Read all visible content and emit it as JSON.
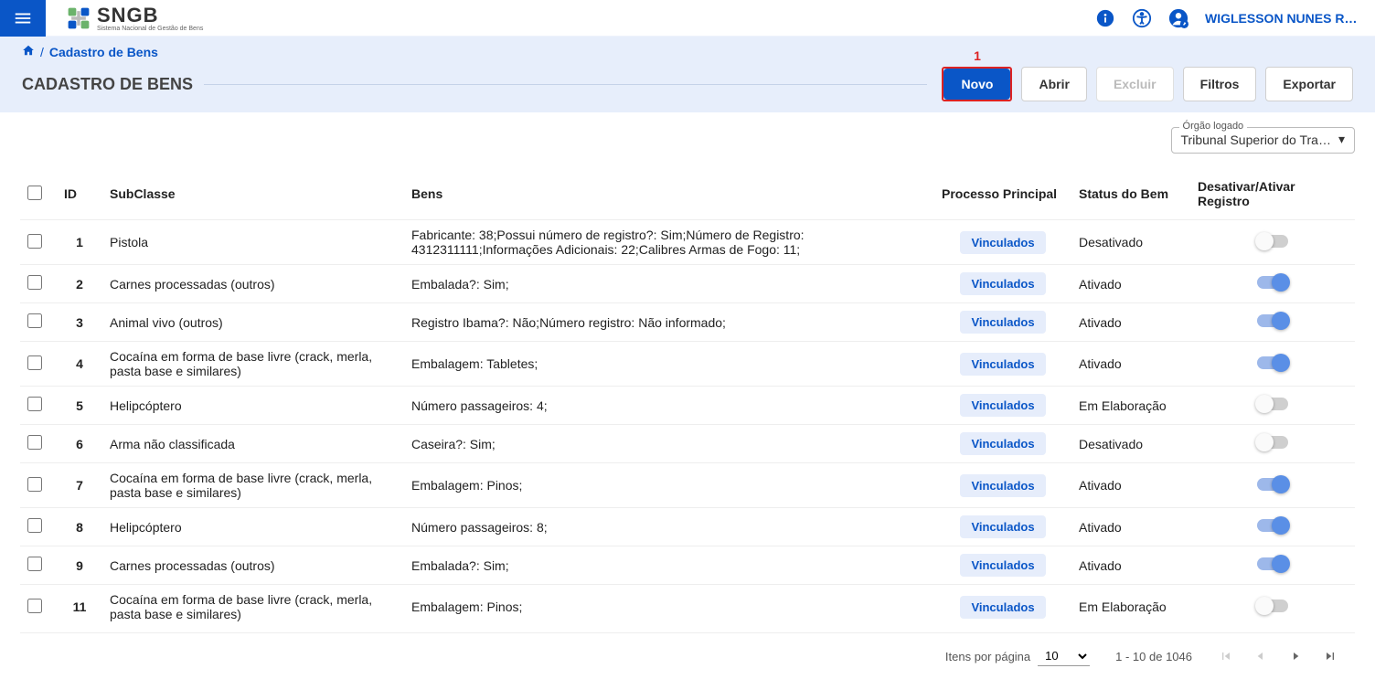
{
  "topbar": {
    "logo_text": "SNGB",
    "logo_sub": "Sistema Nacional de Gestão de Bens",
    "user_name": "WIGLESSON NUNES RO…"
  },
  "breadcrumb": {
    "home_label": "",
    "current": "Cadastro de Bens"
  },
  "page_title": "CADASTRO DE BENS",
  "actions": {
    "novo": "Novo",
    "abrir": "Abrir",
    "excluir": "Excluir",
    "filtros": "Filtros",
    "exportar": "Exportar",
    "highlight_marker": "1"
  },
  "orgao": {
    "label": "Órgão logado",
    "value": "Tribunal Superior do Tra…"
  },
  "table": {
    "headers": {
      "id": "ID",
      "subclasse": "SubClasse",
      "bens": "Bens",
      "processo": "Processo Principal",
      "status": "Status do Bem",
      "toggle": "Desativar/Ativar Registro"
    },
    "vinculados_label": "Vinculados",
    "rows": [
      {
        "id": "1",
        "sub": "Pistola",
        "bens": "Fabricante: 38;Possui número de registro?: Sim;Número de Registro: 4312311111;Informações Adicionais: 22;Calibres Armas de Fogo: 11;",
        "status": "Desativado",
        "active": false
      },
      {
        "id": "2",
        "sub": "Carnes processadas (outros)",
        "bens": "Embalada?: Sim;",
        "status": "Ativado",
        "active": true
      },
      {
        "id": "3",
        "sub": "Animal vivo (outros)",
        "bens": "Registro Ibama?: Não;Número registro: Não informado;",
        "status": "Ativado",
        "active": true
      },
      {
        "id": "4",
        "sub": "Cocaína em forma de base livre (crack, merla, pasta base e similares)",
        "bens": "Embalagem: Tabletes;",
        "status": "Ativado",
        "active": true
      },
      {
        "id": "5",
        "sub": "Helipcóptero",
        "bens": "Número passageiros: 4;",
        "status": "Em Elaboração",
        "active": false
      },
      {
        "id": "6",
        "sub": "Arma não classificada",
        "bens": "Caseira?: Sim;",
        "status": "Desativado",
        "active": false
      },
      {
        "id": "7",
        "sub": "Cocaína em forma de base livre (crack, merla, pasta base e similares)",
        "bens": "Embalagem: Pinos;",
        "status": "Ativado",
        "active": true
      },
      {
        "id": "8",
        "sub": "Helipcóptero",
        "bens": "Número passageiros: 8;",
        "status": "Ativado",
        "active": true
      },
      {
        "id": "9",
        "sub": "Carnes processadas (outros)",
        "bens": "Embalada?: Sim;",
        "status": "Ativado",
        "active": true
      },
      {
        "id": "11",
        "sub": "Cocaína em forma de base livre (crack, merla, pasta base e similares)",
        "bens": "Embalagem: Pinos;",
        "status": "Em Elaboração",
        "active": false
      }
    ]
  },
  "pagination": {
    "items_label": "Itens por página",
    "page_size": "10",
    "range": "1 - 10 de 1046"
  }
}
